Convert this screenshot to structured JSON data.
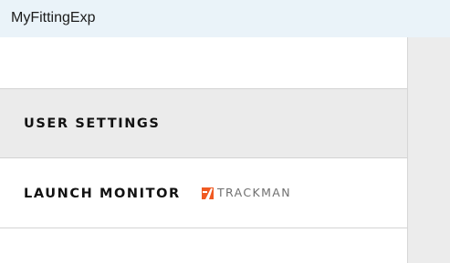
{
  "window": {
    "title": "MyFittingExp"
  },
  "settings": {
    "rows": [
      {
        "label": "USER SETTINGS",
        "selected": true
      },
      {
        "label": "LAUNCH MONITOR",
        "selected": false,
        "brand": {
          "name": "TRACKMAN",
          "icon": "trackman-logo-icon"
        }
      }
    ]
  },
  "colors": {
    "titlebar_bg": "#eaf3f9",
    "selected_row_bg": "#ebebeb",
    "brand_orange": "#f05a22",
    "brand_text": "#6f6f6f"
  }
}
